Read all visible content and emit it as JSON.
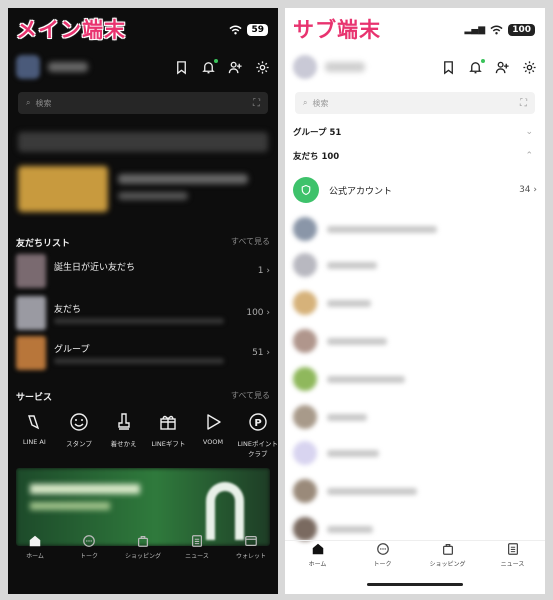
{
  "main": {
    "caption": "メイン端末",
    "battery": "59",
    "search_placeholder": "検索",
    "friends_list": {
      "title": "友だちリスト",
      "more": "すべて見る",
      "rows": [
        {
          "label": "誕生日が近い友だち",
          "count": "1"
        },
        {
          "label": "友だち",
          "count": "100"
        },
        {
          "label": "グループ",
          "count": "51"
        }
      ]
    },
    "services": {
      "title": "サービス",
      "more": "すべて見る",
      "items": [
        {
          "label": "LINE AI",
          "icon": "line-ai-icon"
        },
        {
          "label": "スタンプ",
          "icon": "sticker-icon"
        },
        {
          "label": "着せかえ",
          "icon": "theme-icon"
        },
        {
          "label": "LINEギフト",
          "icon": "gift-icon"
        },
        {
          "label": "VOOM",
          "icon": "voom-icon"
        },
        {
          "label": "LINEポイントクラブ",
          "icon": "points-icon"
        }
      ]
    },
    "tabs": [
      {
        "label": "ホーム",
        "icon": "home-icon"
      },
      {
        "label": "トーク",
        "icon": "chat-icon"
      },
      {
        "label": "ショッピング",
        "icon": "shopping-icon"
      },
      {
        "label": "ニュース",
        "icon": "news-icon"
      },
      {
        "label": "ウォレット",
        "icon": "wallet-icon"
      }
    ]
  },
  "sub": {
    "caption": "サブ端末",
    "battery": "100",
    "search_placeholder": "検索",
    "groups_label": "グループ 51",
    "friends_label": "友だち 100",
    "official_label": "公式アカウント",
    "official_count": "34",
    "tabs": [
      {
        "label": "ホーム",
        "icon": "home-icon"
      },
      {
        "label": "トーク",
        "icon": "chat-icon"
      },
      {
        "label": "ショッピング",
        "icon": "shopping-icon"
      },
      {
        "label": "ニュース",
        "icon": "news-icon"
      }
    ]
  },
  "colors": {
    "caption": "#e8336f",
    "line_green": "#3ec26b",
    "dark_bg": "#0d0d0d",
    "light_bg": "#ffffff"
  }
}
